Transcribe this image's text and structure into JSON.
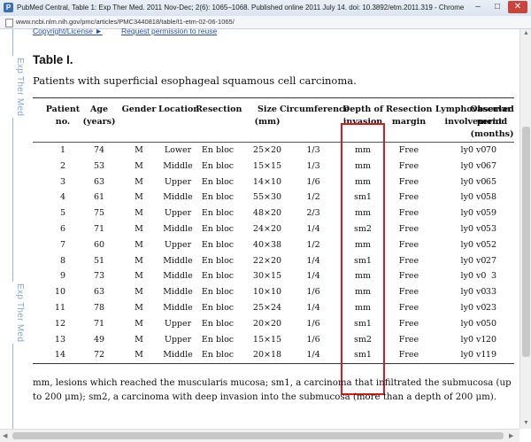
{
  "window": {
    "title": "PubMed Central, Table 1: Exp Ther Med. 2011 Nov-Dec; 2(6): 1065–1068. Published online 2011 July 14. doi: 10.3892/etm.2011.319 - Chrome",
    "url": "www.ncbi.nlm.nih.gov/pmc/articles/PMC3440818/table/t1-etm-02-06-1065/"
  },
  "sidebar": {
    "brand_text": "Exp Ther Med"
  },
  "links": {
    "copyright": "Copyright/License ►",
    "permission": "Request permission to reuse"
  },
  "table": {
    "title": "Table I.",
    "caption": "Patients with superficial esophageal squamous cell carcinoma.",
    "headers": [
      "Patient\nno.",
      "Age\n(years)",
      "Gender",
      "Location",
      "Resection",
      "Size\n(mm)",
      "Circumference",
      "Depth of\ninvasion",
      "Resection\nmargin",
      "Lymphovascular\ninvolvement",
      "Observed\nperiod\n(months)"
    ],
    "rows": [
      [
        "1",
        "74",
        "M",
        "Lower",
        "En bloc",
        "25×20",
        "1/3",
        "mm",
        "Free",
        "ly0 v0",
        "70"
      ],
      [
        "2",
        "53",
        "M",
        "Middle",
        "En bloc",
        "15×15",
        "1/3",
        "mm",
        "Free",
        "ly0 v0",
        "67"
      ],
      [
        "3",
        "63",
        "M",
        "Upper",
        "En bloc",
        "14×10",
        "1/6",
        "mm",
        "Free",
        "ly0 v0",
        "65"
      ],
      [
        "4",
        "61",
        "M",
        "Middle",
        "En bloc",
        "55×30",
        "1/2",
        "sm1",
        "Free",
        "ly0 v0",
        "58"
      ],
      [
        "5",
        "75",
        "M",
        "Upper",
        "En bloc",
        "48×20",
        "2/3",
        "mm",
        "Free",
        "ly0 v0",
        "59"
      ],
      [
        "6",
        "71",
        "M",
        "Middle",
        "En bloc",
        "24×20",
        "1/4",
        "sm2",
        "Free",
        "ly0 v0",
        "53"
      ],
      [
        "7",
        "60",
        "M",
        "Upper",
        "En bloc",
        "40×38",
        "1/2",
        "mm",
        "Free",
        "ly0 v0",
        "52"
      ],
      [
        "8",
        "51",
        "M",
        "Middle",
        "En bloc",
        "22×20",
        "1/4",
        "sm1",
        "Free",
        "ly0 v0",
        "27"
      ],
      [
        "9",
        "73",
        "M",
        "Middle",
        "En bloc",
        "30×15",
        "1/4",
        "mm",
        "Free",
        "ly0 v0",
        "3"
      ],
      [
        "10",
        "63",
        "M",
        "Middle",
        "En bloc",
        "10×10",
        "1/6",
        "mm",
        "Free",
        "ly0 v0",
        "33"
      ],
      [
        "11",
        "78",
        "M",
        "Middle",
        "En bloc",
        "25×24",
        "1/4",
        "mm",
        "Free",
        "ly0 v0",
        "23"
      ],
      [
        "12",
        "71",
        "M",
        "Upper",
        "En bloc",
        "20×20",
        "1/6",
        "sm1",
        "Free",
        "ly0 v0",
        "50"
      ],
      [
        "13",
        "49",
        "M",
        "Upper",
        "En bloc",
        "15×15",
        "1/6",
        "sm2",
        "Free",
        "ly0 v1",
        "20"
      ],
      [
        "14",
        "72",
        "M",
        "Middle",
        "En bloc",
        "20×18",
        "1/4",
        "sm1",
        "Free",
        "ly0 v1",
        "19"
      ]
    ],
    "footnote": "mm, lesions which reached the muscularis mucosa; sm1, a carcinoma that infiltrated the submucosa (up to 200 μm); sm2, a carcinoma with deep invasion into the submucosa (more than a depth of 200 μm).",
    "highlight_color": "#e0191f"
  }
}
